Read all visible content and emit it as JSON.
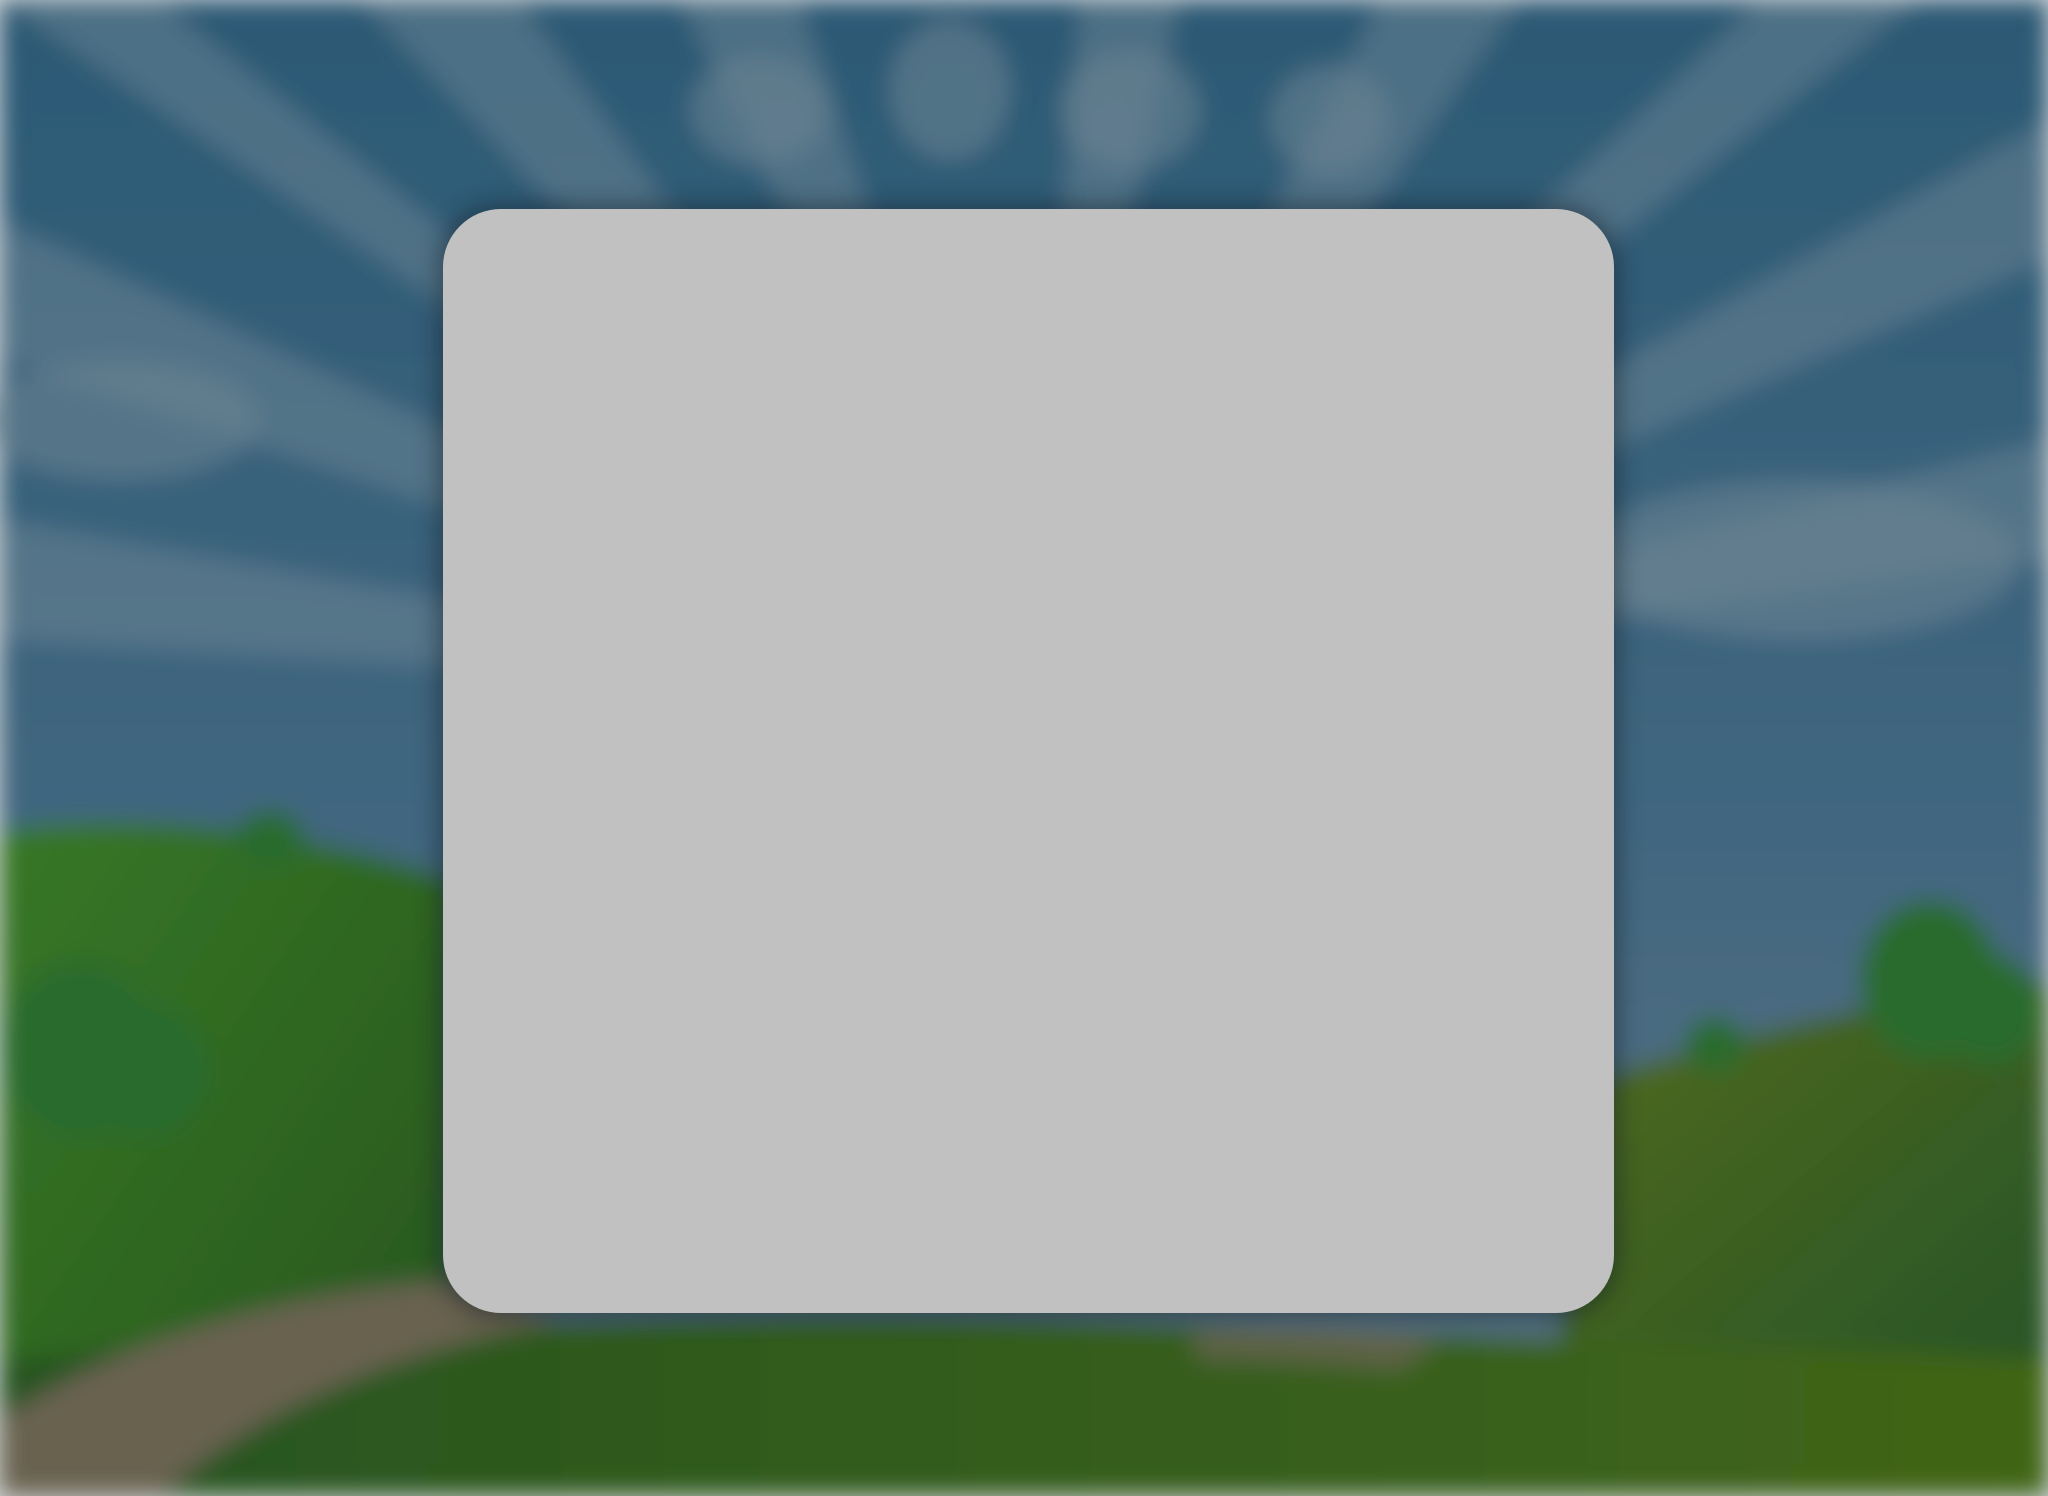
{
  "scene": {
    "sky_color": "#3f6e8a",
    "sky_ray_color": "#7f9aa8",
    "hill_color_light": "#4f7f1c",
    "hill_color_dark": "#2e6420",
    "path_color": "#7b7055",
    "bush_color": "#2f7a2a"
  },
  "modal": {
    "background_color": "#c1c1c1",
    "content": ""
  }
}
